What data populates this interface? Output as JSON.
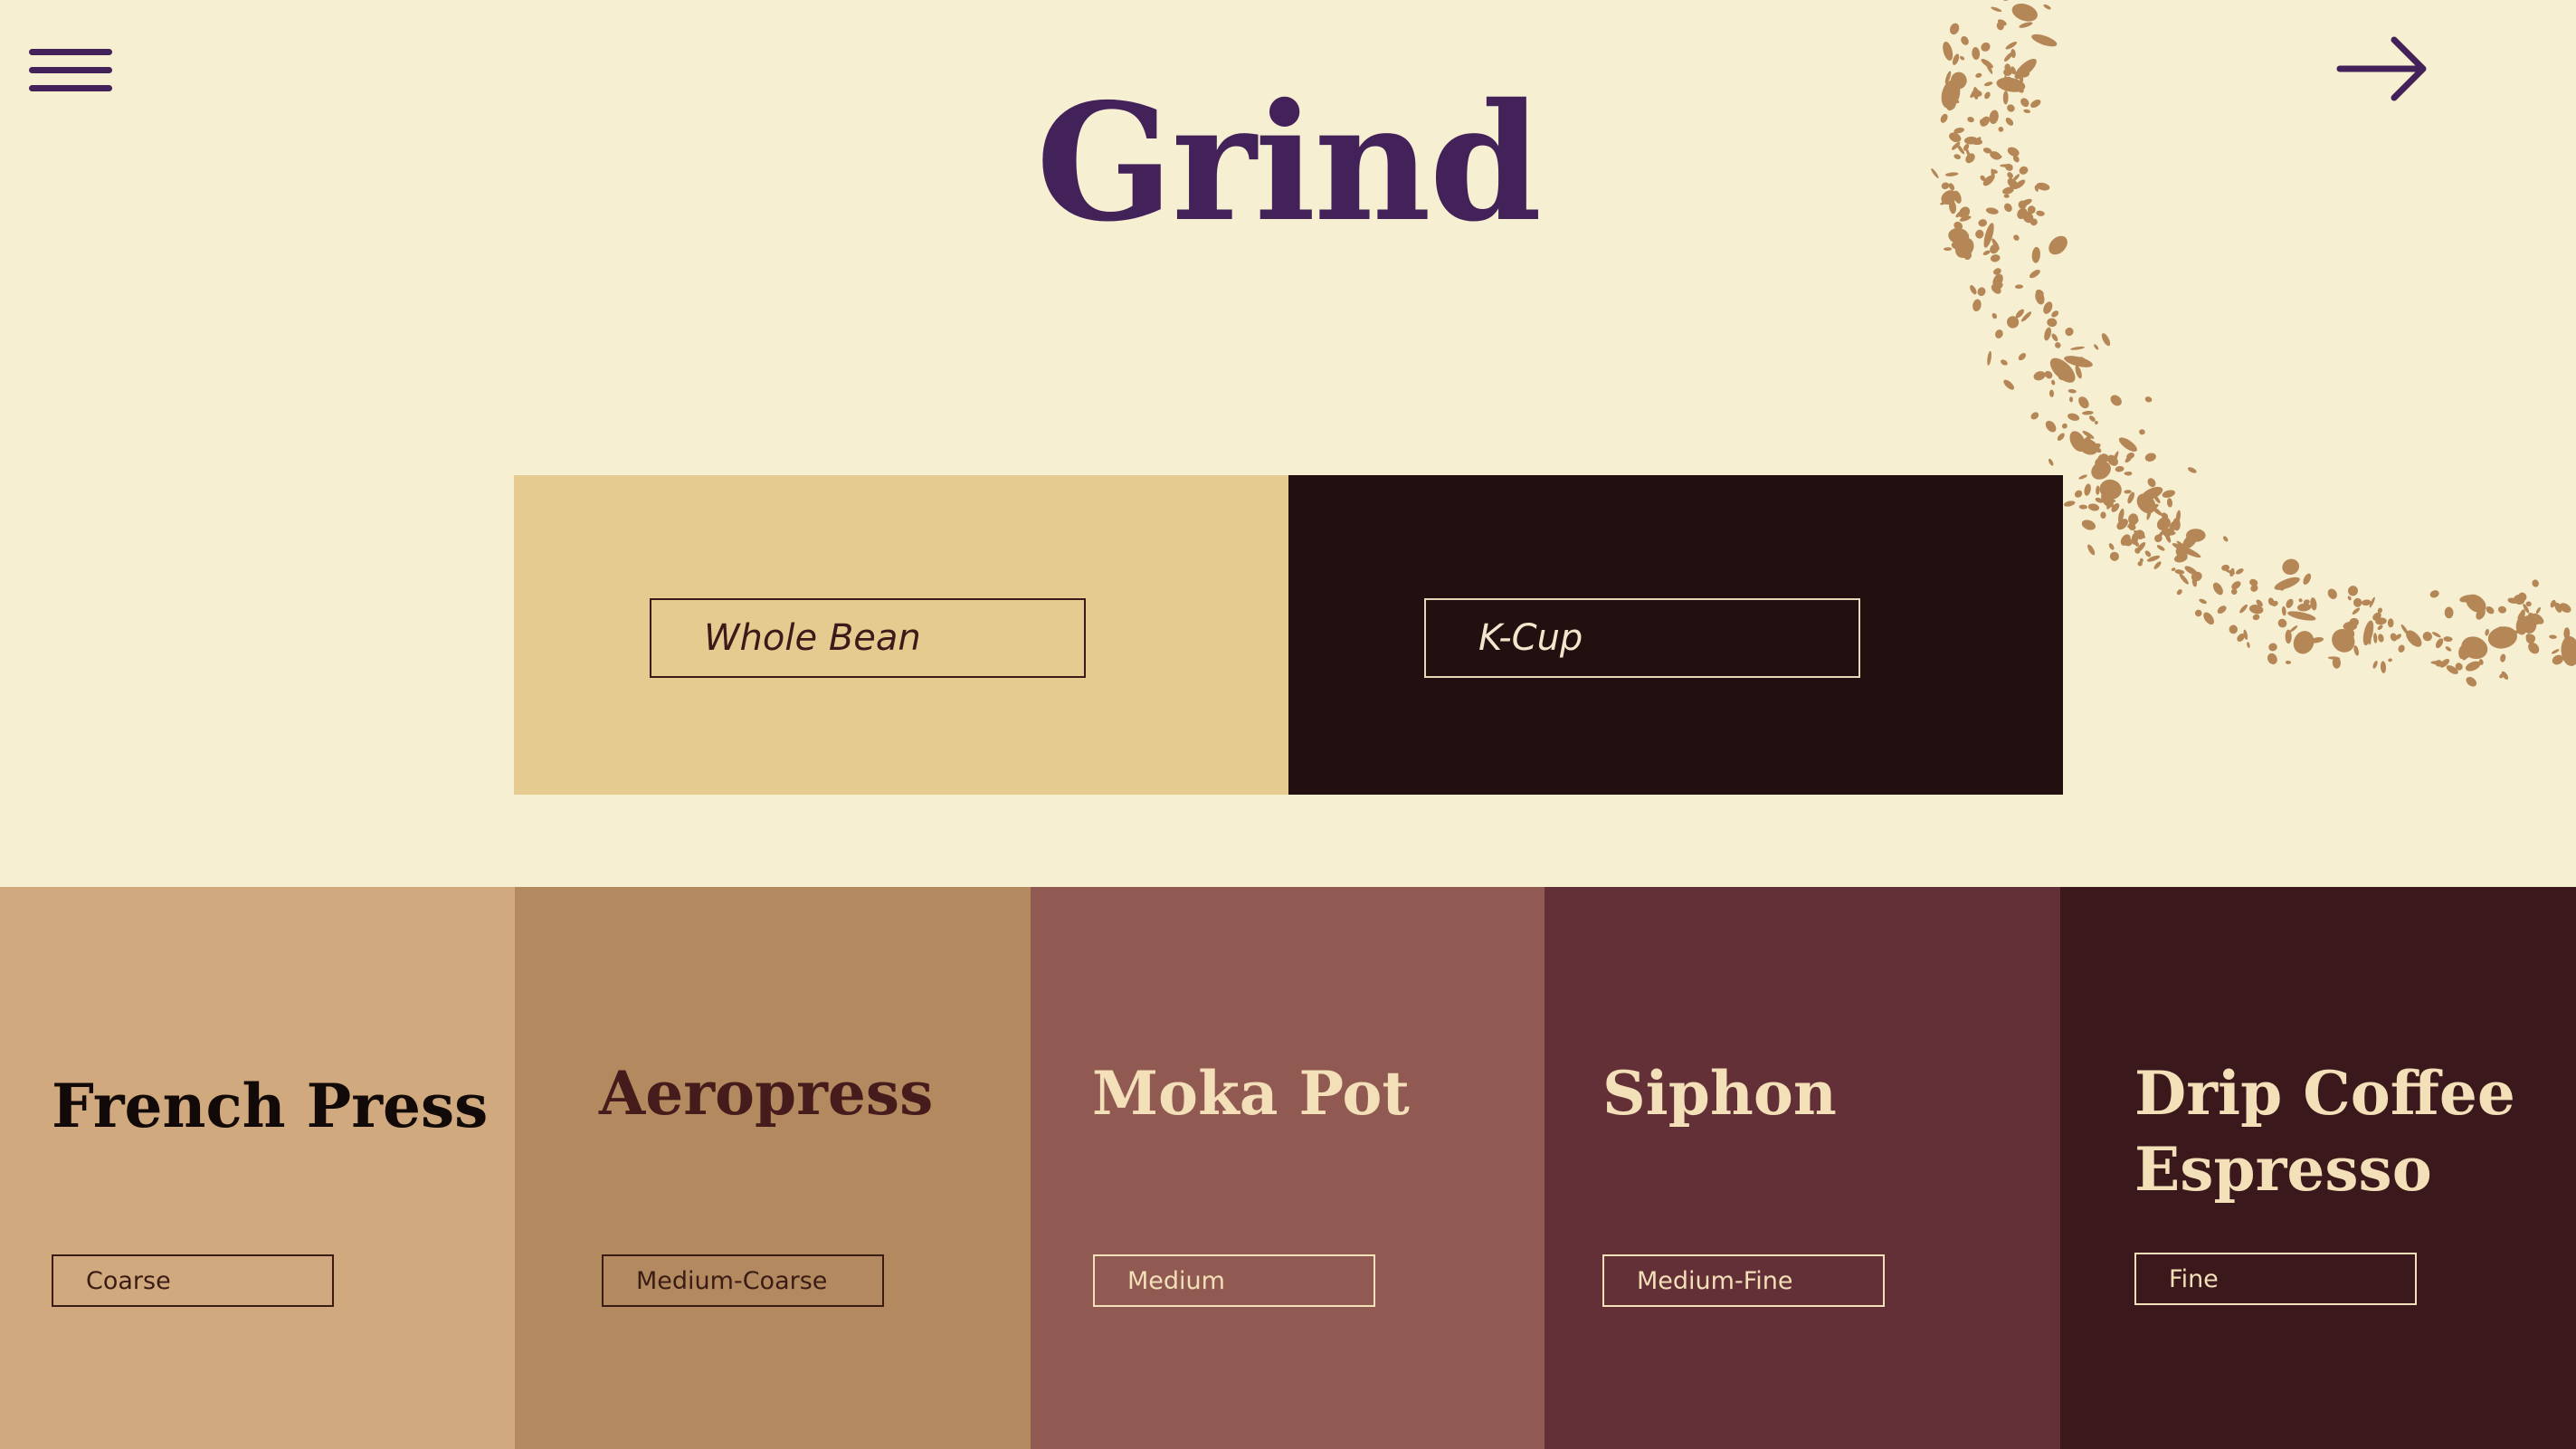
{
  "header": {
    "title": "Grind",
    "menu_icon": "hamburger-menu-icon",
    "next_icon": "arrow-right-icon"
  },
  "formats": [
    {
      "label": "Whole Bean",
      "bg": "#e5cb90",
      "text_color": "#3b1a1a"
    },
    {
      "label": "K-Cup",
      "bg": "#220f10",
      "text_color": "#f4e6cc"
    }
  ],
  "methods": [
    {
      "title": "French Press",
      "grind": "Coarse",
      "bg": "#d1a97e",
      "title_color": "#120a08",
      "button_color": "#3a1c14"
    },
    {
      "title": "Aeropress",
      "grind": "Medium-Coarse",
      "bg": "#b38a60",
      "title_color": "#461b1b",
      "button_color": "#3a1c14"
    },
    {
      "title": "Moka Pot",
      "grind": "Medium",
      "bg": "#905a52",
      "title_color": "#f3dfb8",
      "button_color": "#f3dfb8"
    },
    {
      "title": "Siphon",
      "grind": "Medium-Fine",
      "bg": "#643037",
      "title_color": "#f3dfb8",
      "button_color": "#f3dfb8"
    },
    {
      "title": "Drip Coffee Espresso",
      "title_line1": "Drip Coffee",
      "title_line2": "Espresso",
      "grind": "Fine",
      "bg": "#3b181b",
      "title_color": "#f3dfb8",
      "button_color": "#f3dfb8"
    }
  ],
  "colors": {
    "page_bg": "#f7efd2",
    "accent": "#432259",
    "coffee_grounds": "#b58757"
  }
}
